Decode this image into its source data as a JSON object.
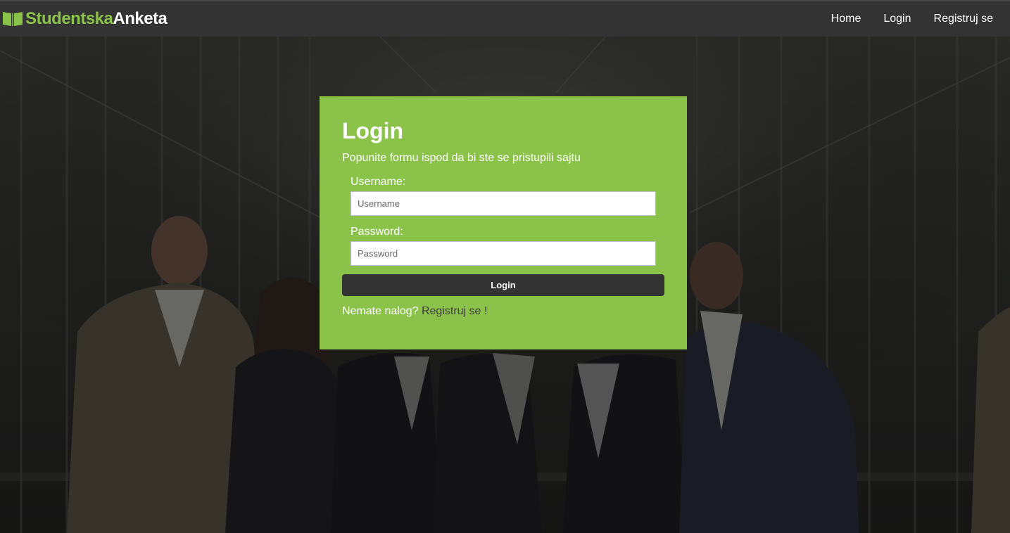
{
  "brand": {
    "part1": "Studentska",
    "part2": "Anketa",
    "icon": "book-icon"
  },
  "nav": {
    "home": "Home",
    "login": "Login",
    "register": "Registruj se"
  },
  "login": {
    "title": "Login",
    "subtitle": "Popunite formu ispod da bi ste se pristupili sajtu",
    "username_label": "Username:",
    "username_placeholder": "Username",
    "username_value": "",
    "password_label": "Password:",
    "password_placeholder": "Password",
    "password_value": "",
    "button": "Login",
    "no_account": "Nemate nalog?",
    "register_link": "Registruj se !"
  },
  "colors": {
    "accent": "#8bc34a",
    "navbar": "#333333",
    "button": "#333333"
  }
}
